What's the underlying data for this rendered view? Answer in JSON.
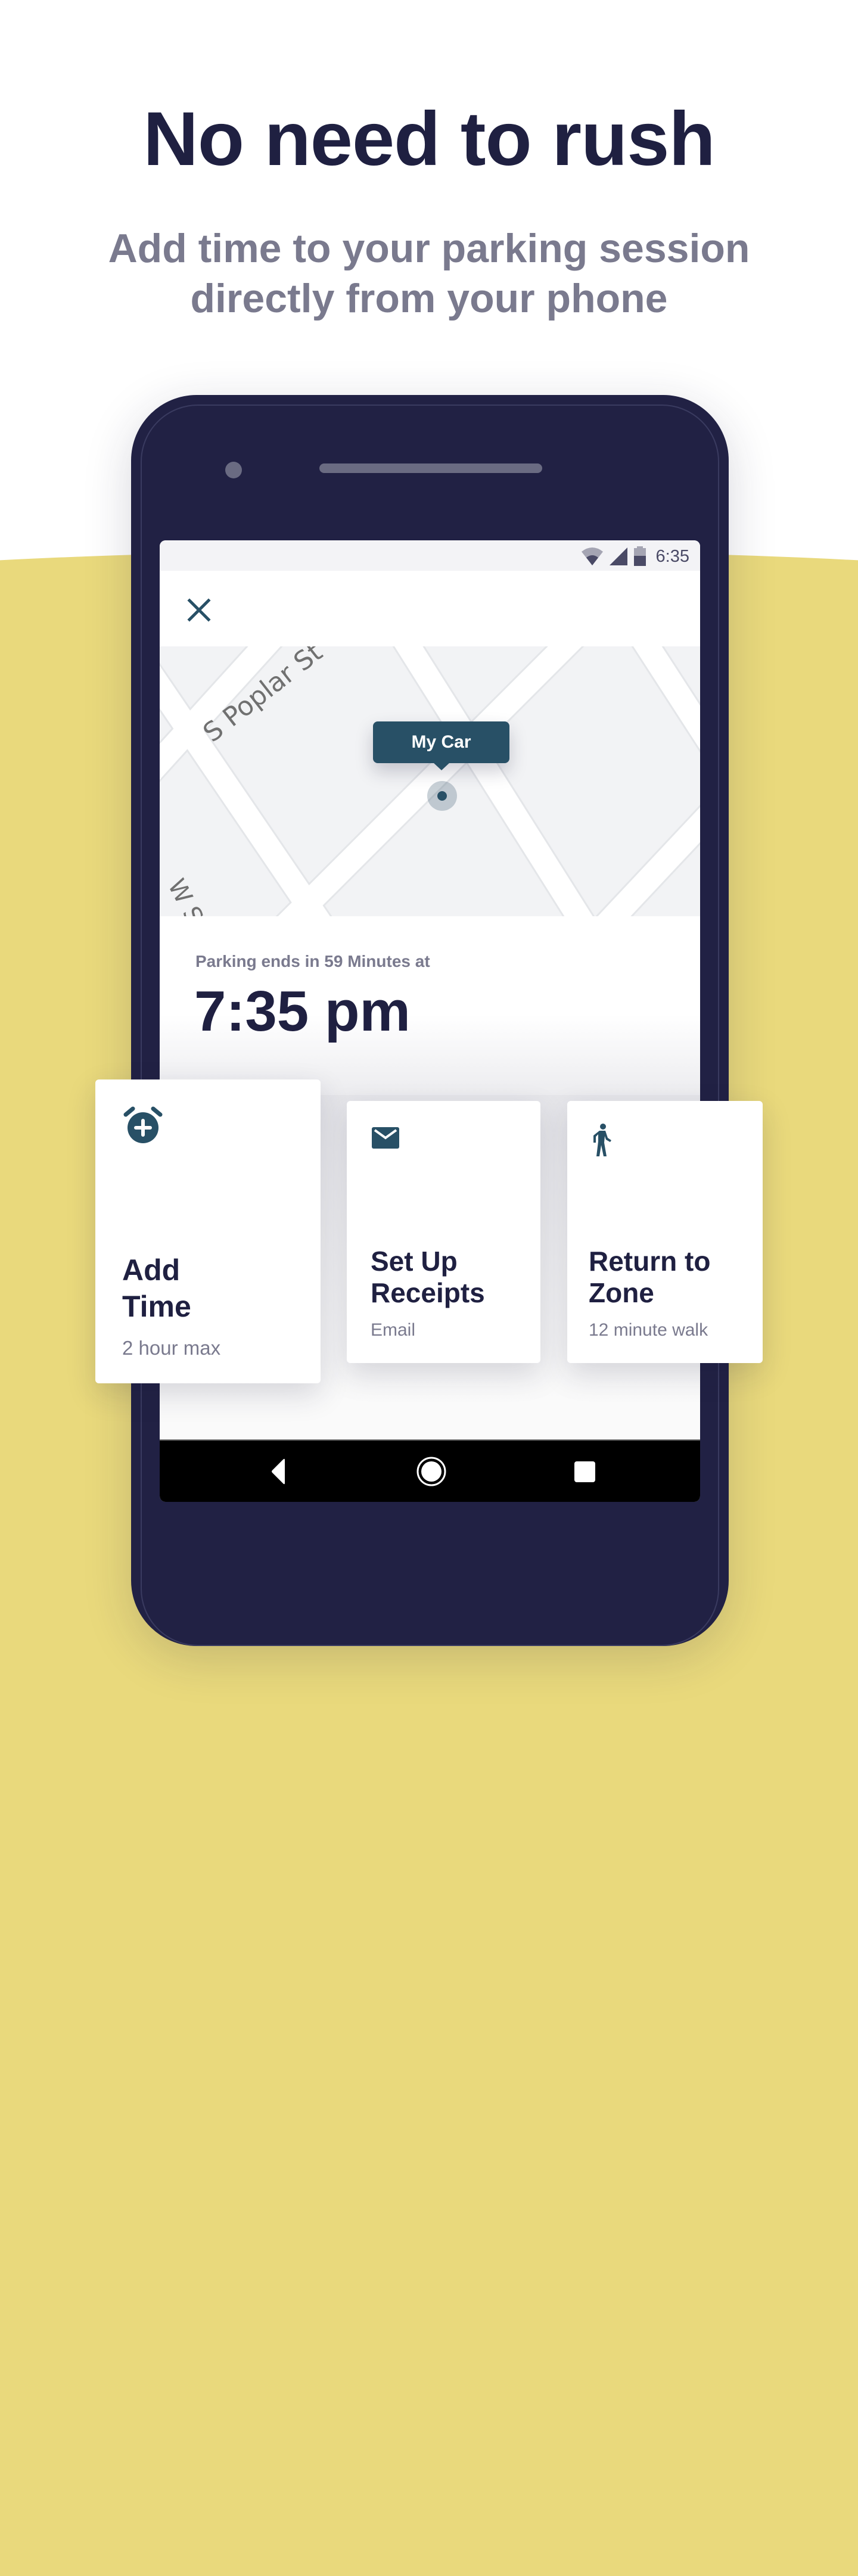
{
  "hero": {
    "title": "No need to rush",
    "subtitle_line1": "Add time to your parking session",
    "subtitle_line2": "directly from your phone"
  },
  "colors": {
    "navy": "#1F2041",
    "accent_teal": "#285066",
    "gray_text": "#7A7A8E",
    "yellow_background": "#E9D97C",
    "phone_body": "#212144"
  },
  "status_bar": {
    "time": "6:35",
    "icons": [
      "wifi-icon",
      "cell-signal-icon",
      "battery-icon"
    ]
  },
  "app_header": {
    "close_icon": "close-icon"
  },
  "map": {
    "street_labels": [
      "S Poplar St",
      "W S"
    ],
    "car_marker_label": "My Car"
  },
  "parking": {
    "ends_label": "Parking ends in 59 Minutes at",
    "end_time": "7:35 pm"
  },
  "cards": [
    {
      "icon": "alarm-add-icon",
      "title": "Add Time",
      "subtitle": "2 hour max"
    },
    {
      "icon": "email-icon",
      "title": "Set Up Receipts",
      "subtitle": "Email"
    },
    {
      "icon": "walk-icon",
      "title": "Return to Zone",
      "subtitle": "12 minute walk"
    }
  ],
  "nav_bar": {
    "buttons": [
      "back",
      "home",
      "recents"
    ]
  }
}
